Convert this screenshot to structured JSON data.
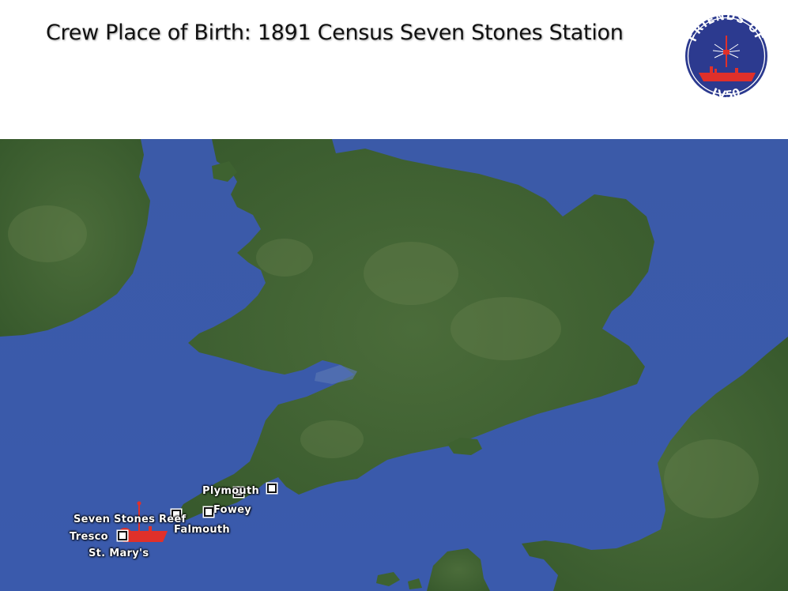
{
  "slide": {
    "title": "Crew Place of Birth: 1891 Census Seven Stones Station"
  },
  "logo": {
    "top_text": "FRIENDS OF",
    "bottom_text": "LV50",
    "icon": "lightship-icon",
    "colors": {
      "background": "#2c3a8f",
      "ring": "#ffffff",
      "ship": "#e0302a"
    }
  },
  "map": {
    "colors": {
      "sea": "#3f5eae",
      "land": "#3f6432",
      "land_light": "#556f3e",
      "marker": "#ffffff",
      "lightship": "#e0302a"
    },
    "places": [
      {
        "name": "Plymouth"
      },
      {
        "name": "Fowey"
      },
      {
        "name": "Seven Stones Reef"
      },
      {
        "name": "Falmouth"
      },
      {
        "name": "Tresco"
      },
      {
        "name": "St. Mary's"
      }
    ]
  }
}
